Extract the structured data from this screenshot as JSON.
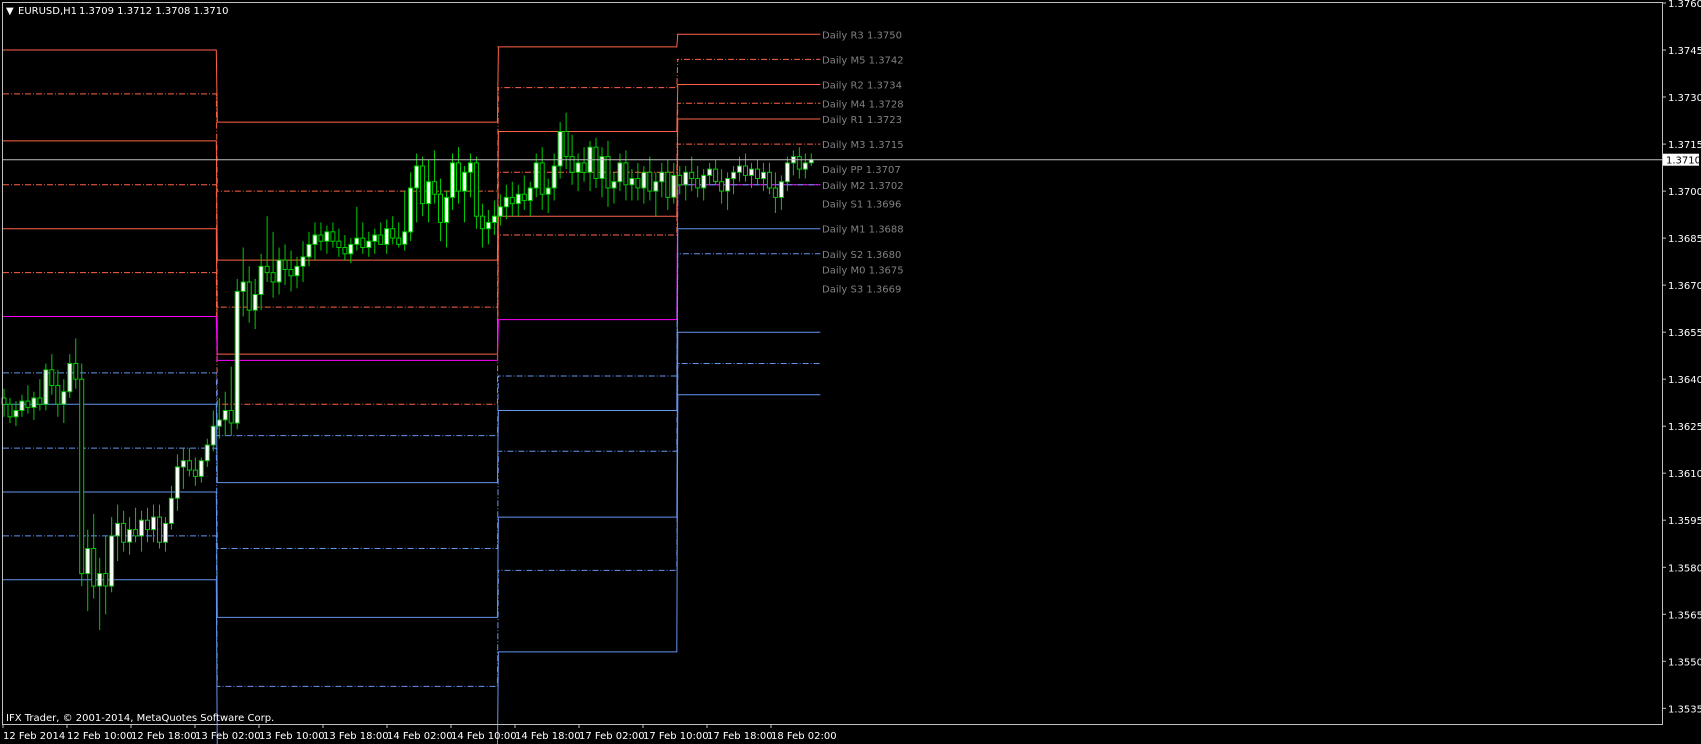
{
  "header": {
    "menu_glyph": "▼",
    "symbol": "EURUSD,H1",
    "ohlc": "1.3709 1.3712 1.3708 1.3710"
  },
  "footer": {
    "copyright": "IFX Trader, © 2001-2014, MetaQuotes Software Corp."
  },
  "colors": {
    "background": "#000000",
    "frame": "#c0c0c0",
    "text": "#ffffff",
    "resistance": "#ff6347",
    "pivot": "#ff00ff",
    "support": "#6495ed",
    "bull_candle": "#ffffff",
    "bear_candle": "#000000",
    "candle_outline": "#00cc00",
    "level_label": "#808080"
  },
  "chart_data": {
    "type": "candlestick",
    "symbol": "EURUSD",
    "timeframe": "H1",
    "ylim": [
      1.353,
      1.376
    ],
    "y_ticks": [
      "1.3760",
      "1.3745",
      "1.3730",
      "1.3715",
      "1.3700",
      "1.3685",
      "1.3670",
      "1.3655",
      "1.3640",
      "1.3625",
      "1.3610",
      "1.3595",
      "1.3580",
      "1.3565",
      "1.3550",
      "1.3535"
    ],
    "x_ticks": [
      "12 Feb 2014",
      "12 Feb 10:00",
      "12 Feb 18:00",
      "13 Feb 02:00",
      "13 Feb 10:00",
      "13 Feb 18:00",
      "14 Feb 02:00",
      "14 Feb 10:00",
      "14 Feb 18:00",
      "17 Feb 02:00",
      "17 Feb 10:00",
      "17 Feb 18:00",
      "18 Feb 02:00"
    ],
    "current_price": "1.3710",
    "current_price_value": 1.371,
    "day_ends": [
      35,
      82,
      112,
      136
    ],
    "pivot_table": [
      {
        "key": "R3",
        "style": "solid",
        "kind": "res",
        "values": [
          1.3745,
          1.3722,
          1.3746,
          1.375
        ]
      },
      {
        "key": "M5",
        "style": "dash",
        "kind": "res",
        "values": [
          1.3731,
          1.37,
          1.3733,
          1.3742
        ]
      },
      {
        "key": "R2",
        "style": "solid",
        "kind": "res",
        "values": [
          1.3716,
          1.3678,
          1.3719,
          1.3734
        ]
      },
      {
        "key": "M4",
        "style": "dash",
        "kind": "res",
        "values": [
          1.3702,
          1.3663,
          1.3706,
          1.3728
        ]
      },
      {
        "key": "R1",
        "style": "solid",
        "kind": "res",
        "values": [
          1.3688,
          1.3648,
          1.3692,
          1.3723
        ]
      },
      {
        "key": "M3",
        "style": "dash",
        "kind": "res",
        "values": [
          1.3674,
          1.3632,
          1.3686,
          1.3715
        ]
      },
      {
        "key": "PP",
        "style": "solid",
        "kind": "pivot",
        "values": [
          1.366,
          1.3646,
          1.3659,
          1.3702
        ]
      },
      {
        "key": "M2",
        "style": "dash",
        "kind": "sup",
        "values": [
          1.3642,
          1.3622,
          1.3641,
          1.3702
        ]
      },
      {
        "key": "S1",
        "style": "solid",
        "kind": "sup",
        "values": [
          1.3632,
          1.3607,
          1.363,
          1.3688
        ]
      },
      {
        "key": "M1",
        "style": "dash",
        "kind": "sup",
        "values": [
          1.3618,
          1.3586,
          1.3617,
          1.368
        ]
      },
      {
        "key": "S2",
        "style": "solid",
        "kind": "sup",
        "values": [
          1.3604,
          1.3564,
          1.3596,
          1.3655
        ]
      },
      {
        "key": "M0",
        "style": "dash",
        "kind": "sup",
        "values": [
          1.359,
          1.3542,
          1.3579,
          1.3645
        ]
      },
      {
        "key": "S3",
        "style": "solid",
        "kind": "sup",
        "values": [
          1.3576,
          1.352,
          1.3553,
          1.3635
        ]
      }
    ],
    "level_labels": [
      {
        "text": "Daily R3 1.3750",
        "value": 1.375,
        "kind": "res"
      },
      {
        "text": "Daily M5 1.3742",
        "value": 1.3742,
        "kind": "res"
      },
      {
        "text": "Daily R2 1.3734",
        "value": 1.3734,
        "kind": "res"
      },
      {
        "text": "Daily M4 1.3728",
        "value": 1.3728,
        "kind": "res"
      },
      {
        "text": "Daily R1 1.3723",
        "value": 1.3723,
        "kind": "res"
      },
      {
        "text": "Daily M3 1.3715",
        "value": 1.3715,
        "kind": "res"
      },
      {
        "text": "Daily PP 1.3707",
        "value": 1.3707,
        "kind": "pivot"
      },
      {
        "text": "Daily M2 1.3702",
        "value": 1.3702,
        "kind": "sup"
      },
      {
        "text": "Daily S1 1.3696",
        "value": 1.3696,
        "kind": "sup"
      },
      {
        "text": "Daily M1 1.3688",
        "value": 1.3688,
        "kind": "sup"
      },
      {
        "text": "Daily S2 1.3680",
        "value": 1.368,
        "kind": "sup"
      },
      {
        "text": "Daily M0 1.3675",
        "value": 1.3675,
        "kind": "sup"
      },
      {
        "text": "Daily S3 1.3669",
        "value": 1.3669,
        "kind": "sup"
      }
    ],
    "candles": [
      [
        1.3634,
        1.3637,
        1.3628,
        1.3632
      ],
      [
        1.3632,
        1.3634,
        1.3626,
        1.3628
      ],
      [
        1.3628,
        1.3633,
        1.3625,
        1.363
      ],
      [
        1.363,
        1.3635,
        1.3628,
        1.3633
      ],
      [
        1.3633,
        1.3638,
        1.3629,
        1.3631
      ],
      [
        1.3631,
        1.3636,
        1.3627,
        1.3634
      ],
      [
        1.3634,
        1.364,
        1.363,
        1.3632
      ],
      [
        1.3632,
        1.3645,
        1.363,
        1.3643
      ],
      [
        1.3643,
        1.3648,
        1.3635,
        1.3638
      ],
      [
        1.3638,
        1.3643,
        1.3628,
        1.3632
      ],
      [
        1.3632,
        1.364,
        1.3626,
        1.3636
      ],
      [
        1.3636,
        1.3648,
        1.3634,
        1.3645
      ],
      [
        1.3645,
        1.3653,
        1.3637,
        1.364
      ],
      [
        1.364,
        1.3645,
        1.3574,
        1.3578
      ],
      [
        1.3578,
        1.3592,
        1.3566,
        1.3586
      ],
      [
        1.3586,
        1.3597,
        1.357,
        1.3574
      ],
      [
        1.3574,
        1.3583,
        1.356,
        1.3578
      ],
      [
        1.3578,
        1.359,
        1.3565,
        1.3574
      ],
      [
        1.3574,
        1.3596,
        1.3572,
        1.359
      ],
      [
        1.359,
        1.36,
        1.3582,
        1.3594
      ],
      [
        1.3594,
        1.3598,
        1.3585,
        1.3588
      ],
      [
        1.3588,
        1.3596,
        1.3584,
        1.3592
      ],
      [
        1.3592,
        1.3599,
        1.3588,
        1.359
      ],
      [
        1.359,
        1.3598,
        1.3585,
        1.3595
      ],
      [
        1.3595,
        1.3599,
        1.3588,
        1.3592
      ],
      [
        1.3592,
        1.36,
        1.3588,
        1.3596
      ],
      [
        1.3596,
        1.36,
        1.3586,
        1.3588
      ],
      [
        1.3588,
        1.3596,
        1.3585,
        1.3594
      ],
      [
        1.3594,
        1.3606,
        1.3592,
        1.3602
      ],
      [
        1.3602,
        1.3616,
        1.3598,
        1.3612
      ],
      [
        1.3612,
        1.3618,
        1.3605,
        1.3614
      ],
      [
        1.3614,
        1.3618,
        1.3609,
        1.3611
      ],
      [
        1.3611,
        1.3615,
        1.3606,
        1.3609
      ],
      [
        1.3609,
        1.3615,
        1.3607,
        1.3614
      ],
      [
        1.3614,
        1.3621,
        1.3612,
        1.3619
      ],
      [
        1.3619,
        1.363,
        1.3617,
        1.3625
      ],
      [
        1.3625,
        1.3634,
        1.3621,
        1.3627
      ],
      [
        1.3627,
        1.3636,
        1.3622,
        1.363
      ],
      [
        1.363,
        1.3644,
        1.3622,
        1.3626
      ],
      [
        1.3626,
        1.3672,
        1.3624,
        1.3668
      ],
      [
        1.3668,
        1.3682,
        1.366,
        1.3671
      ],
      [
        1.3671,
        1.3676,
        1.3658,
        1.3662
      ],
      [
        1.3662,
        1.3672,
        1.3656,
        1.3667
      ],
      [
        1.3667,
        1.368,
        1.3662,
        1.3676
      ],
      [
        1.3676,
        1.3692,
        1.3671,
        1.3674
      ],
      [
        1.3674,
        1.3687,
        1.3666,
        1.3671
      ],
      [
        1.3671,
        1.3682,
        1.3667,
        1.3678
      ],
      [
        1.3678,
        1.3683,
        1.367,
        1.3675
      ],
      [
        1.3675,
        1.3681,
        1.3668,
        1.3673
      ],
      [
        1.3673,
        1.3679,
        1.3669,
        1.3676
      ],
      [
        1.3676,
        1.3684,
        1.3671,
        1.3679
      ],
      [
        1.3679,
        1.3687,
        1.3676,
        1.3683
      ],
      [
        1.3683,
        1.369,
        1.3678,
        1.3686
      ],
      [
        1.3686,
        1.369,
        1.3681,
        1.3684
      ],
      [
        1.3684,
        1.3689,
        1.368,
        1.3687
      ],
      [
        1.3687,
        1.369,
        1.3682,
        1.3684
      ],
      [
        1.3684,
        1.3688,
        1.3679,
        1.3682
      ],
      [
        1.3682,
        1.3686,
        1.3678,
        1.368
      ],
      [
        1.368,
        1.3685,
        1.3677,
        1.3683
      ],
      [
        1.3683,
        1.3695,
        1.3681,
        1.3685
      ],
      [
        1.3685,
        1.369,
        1.368,
        1.3682
      ],
      [
        1.3682,
        1.3687,
        1.3679,
        1.3684
      ],
      [
        1.3684,
        1.3688,
        1.368,
        1.3686
      ],
      [
        1.3686,
        1.369,
        1.3683,
        1.3683
      ],
      [
        1.3683,
        1.3691,
        1.368,
        1.3688
      ],
      [
        1.3688,
        1.3692,
        1.3683,
        1.3685
      ],
      [
        1.3685,
        1.369,
        1.3682,
        1.3683
      ],
      [
        1.3683,
        1.37,
        1.3681,
        1.3687
      ],
      [
        1.3687,
        1.3706,
        1.3684,
        1.3701
      ],
      [
        1.3701,
        1.3712,
        1.369,
        1.3708
      ],
      [
        1.3708,
        1.3711,
        1.3692,
        1.3696
      ],
      [
        1.3696,
        1.371,
        1.369,
        1.3703
      ],
      [
        1.3703,
        1.3713,
        1.3696,
        1.3699
      ],
      [
        1.3699,
        1.3704,
        1.3684,
        1.369
      ],
      [
        1.369,
        1.37,
        1.3682,
        1.3698
      ],
      [
        1.3698,
        1.3712,
        1.3694,
        1.3709
      ],
      [
        1.3709,
        1.3714,
        1.3696,
        1.37
      ],
      [
        1.37,
        1.3708,
        1.369,
        1.3706
      ],
      [
        1.3706,
        1.3712,
        1.3698,
        1.3709
      ],
      [
        1.3709,
        1.3711,
        1.3688,
        1.3692
      ],
      [
        1.3692,
        1.3696,
        1.3682,
        1.3688
      ],
      [
        1.3688,
        1.3694,
        1.3683,
        1.369
      ],
      [
        1.369,
        1.3697,
        1.3686,
        1.3692
      ],
      [
        1.3692,
        1.3699,
        1.3689,
        1.3695
      ],
      [
        1.3695,
        1.3702,
        1.3691,
        1.3698
      ],
      [
        1.3698,
        1.3703,
        1.3692,
        1.3696
      ],
      [
        1.3696,
        1.3702,
        1.3692,
        1.3699
      ],
      [
        1.3699,
        1.3705,
        1.3694,
        1.3697
      ],
      [
        1.3697,
        1.3703,
        1.3692,
        1.3701
      ],
      [
        1.3701,
        1.3712,
        1.3698,
        1.3709
      ],
      [
        1.3709,
        1.3714,
        1.3694,
        1.3699
      ],
      [
        1.3699,
        1.3704,
        1.3693,
        1.3701
      ],
      [
        1.3701,
        1.3712,
        1.3697,
        1.3708
      ],
      [
        1.3708,
        1.3722,
        1.3704,
        1.3719
      ],
      [
        1.3719,
        1.3725,
        1.3707,
        1.3711
      ],
      [
        1.3711,
        1.3718,
        1.3702,
        1.3706
      ],
      [
        1.3706,
        1.3712,
        1.37,
        1.3709
      ],
      [
        1.3709,
        1.3714,
        1.3703,
        1.3706
      ],
      [
        1.3706,
        1.3716,
        1.37,
        1.3714
      ],
      [
        1.3714,
        1.3717,
        1.3701,
        1.3704
      ],
      [
        1.3704,
        1.3714,
        1.3698,
        1.3711
      ],
      [
        1.3711,
        1.3716,
        1.3695,
        1.3701
      ],
      [
        1.3701,
        1.3706,
        1.3696,
        1.3703
      ],
      [
        1.3703,
        1.3712,
        1.37,
        1.3709
      ],
      [
        1.3709,
        1.3713,
        1.3697,
        1.3702
      ],
      [
        1.3702,
        1.3707,
        1.3697,
        1.3704
      ],
      [
        1.3704,
        1.3709,
        1.3697,
        1.3701
      ],
      [
        1.3701,
        1.3708,
        1.3696,
        1.3706
      ],
      [
        1.3706,
        1.3711,
        1.3697,
        1.37
      ],
      [
        1.37,
        1.3706,
        1.3692,
        1.3703
      ],
      [
        1.3703,
        1.3709,
        1.3698,
        1.3706
      ],
      [
        1.3706,
        1.371,
        1.3694,
        1.3698
      ],
      [
        1.3698,
        1.3709,
        1.3696,
        1.3705
      ],
      [
        1.3705,
        1.3708,
        1.3699,
        1.3702
      ],
      [
        1.3702,
        1.3708,
        1.3697,
        1.3706
      ],
      [
        1.3706,
        1.3711,
        1.37,
        1.3704
      ],
      [
        1.3704,
        1.3708,
        1.3698,
        1.3701
      ],
      [
        1.3701,
        1.3707,
        1.3697,
        1.3705
      ],
      [
        1.3705,
        1.3709,
        1.3702,
        1.3707
      ],
      [
        1.3707,
        1.371,
        1.3702,
        1.3703
      ],
      [
        1.3703,
        1.3707,
        1.3696,
        1.37
      ],
      [
        1.37,
        1.3706,
        1.3694,
        1.3704
      ],
      [
        1.3704,
        1.3708,
        1.3699,
        1.3706
      ],
      [
        1.3706,
        1.3711,
        1.3703,
        1.3708
      ],
      [
        1.3708,
        1.3712,
        1.3703,
        1.3705
      ],
      [
        1.3705,
        1.3709,
        1.3701,
        1.3707
      ],
      [
        1.3707,
        1.371,
        1.3702,
        1.3704
      ],
      [
        1.3704,
        1.3709,
        1.37,
        1.3706
      ],
      [
        1.3706,
        1.3709,
        1.3699,
        1.3701
      ],
      [
        1.3701,
        1.3706,
        1.3693,
        1.3698
      ],
      [
        1.3698,
        1.3705,
        1.3694,
        1.3703
      ],
      [
        1.3703,
        1.3711,
        1.37,
        1.3709
      ],
      [
        1.3709,
        1.3713,
        1.3705,
        1.3711
      ],
      [
        1.3711,
        1.3714,
        1.3704,
        1.3707
      ],
      [
        1.3707,
        1.3712,
        1.3704,
        1.3709
      ],
      [
        1.3709,
        1.3712,
        1.3708,
        1.371
      ]
    ]
  }
}
